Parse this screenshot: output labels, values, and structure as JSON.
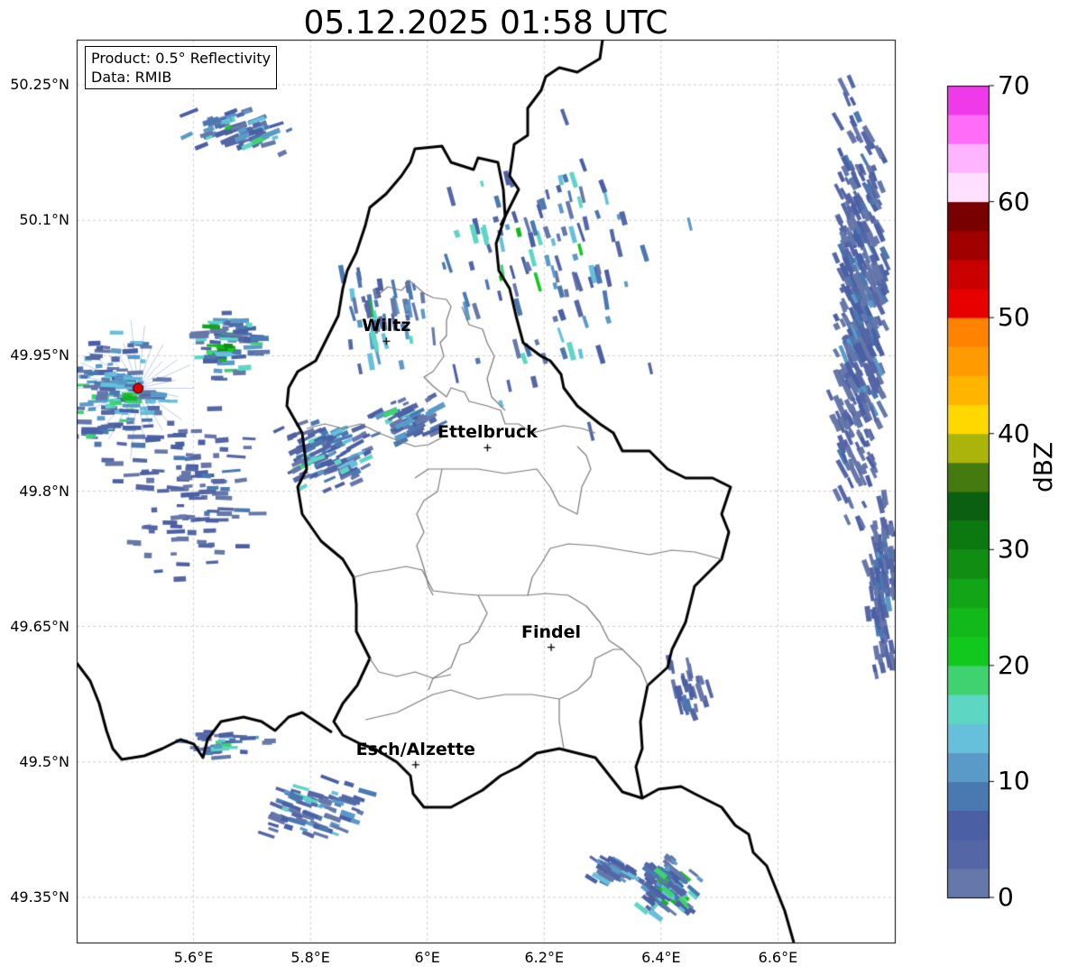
{
  "title": "05.12.2025 01:58 UTC",
  "info": {
    "product": "Product: 0.5° Reflectivity",
    "data": "Data: RMIB"
  },
  "extent": {
    "lon": [
      5.4,
      6.8
    ],
    "lat": [
      49.3,
      50.3
    ]
  },
  "lat_ticks": [
    {
      "value": 50.25,
      "label": "50.25°N"
    },
    {
      "value": 50.1,
      "label": "50.1°N"
    },
    {
      "value": 49.95,
      "label": "49.95°N"
    },
    {
      "value": 49.8,
      "label": "49.8°N"
    },
    {
      "value": 49.65,
      "label": "49.65°N"
    },
    {
      "value": 49.5,
      "label": "49.5°N"
    },
    {
      "value": 49.35,
      "label": "49.35°N"
    }
  ],
  "lon_ticks": [
    {
      "value": 5.6,
      "label": "5.6°E"
    },
    {
      "value": 5.8,
      "label": "5.8°E"
    },
    {
      "value": 6.0,
      "label": "6°E"
    },
    {
      "value": 6.2,
      "label": "6.2°E"
    },
    {
      "value": 6.4,
      "label": "6.4°E"
    },
    {
      "value": 6.6,
      "label": "6.6°E"
    }
  ],
  "cities": [
    {
      "name": "Wiltz",
      "lon": 5.93,
      "lat": 49.966
    },
    {
      "name": "Ettelbruck",
      "lon": 6.103,
      "lat": 49.848
    },
    {
      "name": "Findel",
      "lon": 6.212,
      "lat": 49.627
    },
    {
      "name": "Esch/Alzette",
      "lon": 5.98,
      "lat": 49.497
    }
  ],
  "radar_site": {
    "lon": 5.505,
    "lat": 49.914,
    "color": "#e00000"
  },
  "colorbar": {
    "label": "dBZ",
    "range": [
      0,
      70
    ],
    "ticks": [
      0,
      10,
      20,
      30,
      40,
      50,
      60,
      70
    ],
    "colors": [
      "#6677aa",
      "#5566a6",
      "#4a5fa4",
      "#4a79b1",
      "#5a9ac8",
      "#66c0dc",
      "#5ed6c4",
      "#40d270",
      "#12c81e",
      "#13b81a",
      "#12a518",
      "#118d14",
      "#0c7810",
      "#0a6010",
      "#447a10",
      "#aab40a",
      "#ffd800",
      "#ffb400",
      "#ff9b00",
      "#ff8200",
      "#e60000",
      "#c80000",
      "#a00000",
      "#780000",
      "#ffe0ff",
      "#ffb4ff",
      "#ff6cf8",
      "#ee3ae8"
    ]
  },
  "echoes": [
    {
      "lon": 5.46,
      "lat": 49.91,
      "rlon": 0.12,
      "rlat": 0.08,
      "n": 140,
      "dbz": [
        0,
        28
      ],
      "dir": 0
    },
    {
      "lon": 5.66,
      "lat": 49.96,
      "rlon": 0.08,
      "rlat": 0.05,
      "n": 70,
      "dbz": [
        0,
        38
      ],
      "dir": 0
    },
    {
      "lon": 5.83,
      "lat": 49.84,
      "rlon": 0.1,
      "rlat": 0.05,
      "n": 110,
      "dbz": [
        0,
        26
      ],
      "dir": -25
    },
    {
      "lon": 5.97,
      "lat": 49.88,
      "rlon": 0.09,
      "rlat": 0.03,
      "n": 55,
      "dbz": [
        0,
        24
      ],
      "dir": -25
    },
    {
      "lon": 5.68,
      "lat": 50.2,
      "rlon": 0.12,
      "rlat": 0.03,
      "n": 70,
      "dbz": [
        0,
        24
      ],
      "dir": -20
    },
    {
      "lon": 5.8,
      "lat": 49.45,
      "rlon": 0.12,
      "rlat": 0.04,
      "n": 70,
      "dbz": [
        0,
        24
      ],
      "dir": 20
    },
    {
      "lon": 5.65,
      "lat": 49.52,
      "rlon": 0.09,
      "rlat": 0.02,
      "n": 35,
      "dbz": [
        0,
        22
      ],
      "dir": 0
    },
    {
      "lon": 6.41,
      "lat": 49.36,
      "rlon": 0.06,
      "rlat": 0.04,
      "n": 120,
      "dbz": [
        0,
        30
      ],
      "dir": 40
    },
    {
      "lon": 6.32,
      "lat": 49.38,
      "rlon": 0.05,
      "rlat": 0.02,
      "n": 50,
      "dbz": [
        0,
        20
      ],
      "dir": 30
    },
    {
      "lon": 6.74,
      "lat": 50.0,
      "rlon": 0.06,
      "rlat": 0.3,
      "n": 480,
      "dbz": [
        0,
        14
      ],
      "dir": 65
    },
    {
      "lon": 6.78,
      "lat": 49.7,
      "rlon": 0.03,
      "rlat": 0.12,
      "n": 140,
      "dbz": [
        0,
        14
      ],
      "dir": 80
    },
    {
      "lon": 6.45,
      "lat": 49.58,
      "rlon": 0.05,
      "rlat": 0.05,
      "n": 30,
      "dbz": [
        0,
        12
      ],
      "dir": 75
    },
    {
      "lon": 6.2,
      "lat": 50.05,
      "rlon": 0.28,
      "rlat": 0.2,
      "n": 110,
      "dbz": [
        0,
        26
      ],
      "dir": 75
    },
    {
      "lon": 5.92,
      "lat": 50.0,
      "rlon": 0.12,
      "rlat": 0.08,
      "n": 50,
      "dbz": [
        0,
        26
      ],
      "dir": 80
    },
    {
      "lon": 5.6,
      "lat": 49.8,
      "rlon": 0.18,
      "rlat": 0.12,
      "n": 100,
      "dbz": [
        0,
        12
      ],
      "dir": 0
    }
  ]
}
